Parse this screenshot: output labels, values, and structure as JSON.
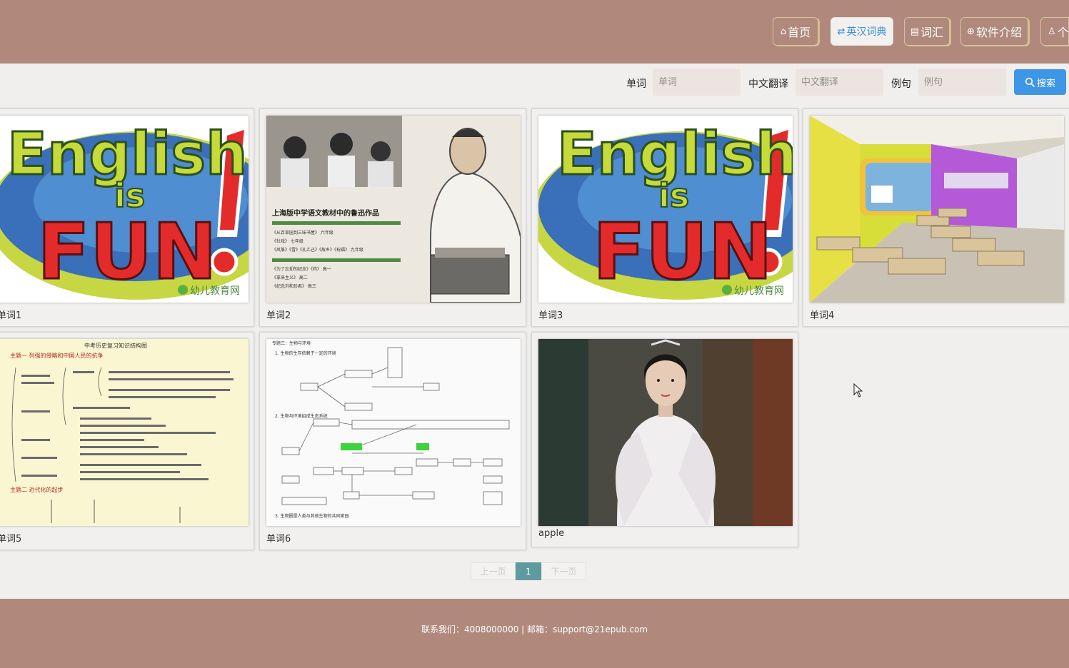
{
  "nav": {
    "items": [
      {
        "icon": "home-icon",
        "glyph": "⌂",
        "label": "首页"
      },
      {
        "icon": "translate-icon",
        "glyph": "⇄",
        "label": "英汉词典"
      },
      {
        "icon": "book-icon",
        "glyph": "▤",
        "label": "词汇"
      },
      {
        "icon": "globe-icon",
        "glyph": "⊕",
        "label": "软件介绍"
      },
      {
        "icon": "user-icon",
        "glyph": "♙",
        "label": "个"
      }
    ],
    "active_index": 1
  },
  "search": {
    "word_label": "单词",
    "word_placeholder": "单词",
    "translation_label": "中文翻译",
    "translation_placeholder": "中文翻译",
    "example_label": "例句",
    "example_placeholder": "例句",
    "button_label": "搜索"
  },
  "cards": [
    {
      "title": "单词1",
      "image": "english-is-fun-image"
    },
    {
      "title": "单词2",
      "image": "lu-xun-textbook-image"
    },
    {
      "title": "单词3",
      "image": "english-is-fun-image"
    },
    {
      "title": "单词4",
      "image": "classroom-image"
    },
    {
      "title": "单词5",
      "image": "history-outline-image"
    },
    {
      "title": "单词6",
      "image": "biology-diagram-image"
    },
    {
      "title": "apple",
      "image": "woman-portrait-image"
    }
  ],
  "images": {
    "fun": {
      "english": "English",
      "is": "is",
      "fun": "FUN",
      "watermark": "幼儿教育网"
    },
    "luxun": {
      "title": "上海版中学语文教材中的鲁迅作品",
      "lines": [
        "《从百草园到三味书屋》 六年级",
        "《社戏》 七年级",
        "《风筝》《雪》《孔乙己》《故乡》《祝福》 九年级",
        "《为了忘却的纪念》《药》 高一",
        "《拿来主义》 高二",
        "《纪念刘和珍君》 高三"
      ]
    },
    "history": {
      "title": "中考历史复习知识结构图",
      "topic1": "主题一 列强的侵略和中国人民的抗争",
      "topic2": "主题二 近代化的起步"
    },
    "biology": {
      "title": "专题三：生物与环境",
      "line1": "1. 生物的生存依赖于一定的环境",
      "line2": "2. 生物与环境组成生态系统",
      "line3": "3. 生物圈是人类与其他生物的共同家园"
    }
  },
  "pagination": {
    "prev": "上一页",
    "current": "1",
    "next": "下一页"
  },
  "footer": {
    "text": "联系我们：4008000000 | 邮箱：support@21epub.com"
  },
  "colors": {
    "header_bg": "#b0897c",
    "accent": "#3e96e6",
    "page_current": "#5f9a9e"
  }
}
